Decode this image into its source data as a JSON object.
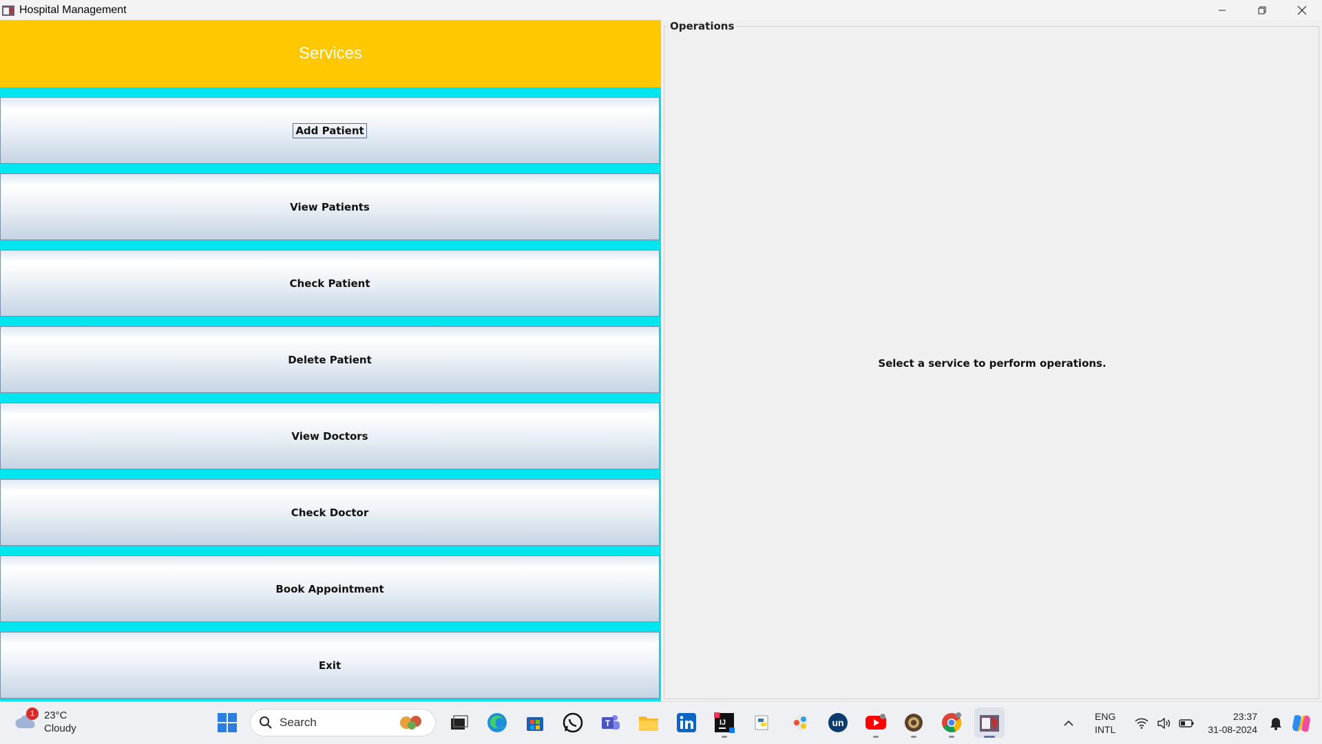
{
  "window": {
    "title": "Hospital Management"
  },
  "services": {
    "title": "Services",
    "buttons": [
      {
        "label": "Add Patient"
      },
      {
        "label": "View Patients"
      },
      {
        "label": "Check Patient"
      },
      {
        "label": "Delete Patient"
      },
      {
        "label": "View Doctors"
      },
      {
        "label": "Check Doctor"
      },
      {
        "label": "Book Appointment"
      },
      {
        "label": "Exit"
      }
    ]
  },
  "operations": {
    "title": "Operations",
    "message": "Select a service to perform operations."
  },
  "taskbar": {
    "weather": {
      "temperature": "23°C",
      "condition": "Cloudy",
      "badge": "1"
    },
    "search_placeholder": "Search",
    "language": {
      "line1": "ENG",
      "line2": "INTL"
    },
    "clock": {
      "time": "23:37",
      "date": "31-08-2024"
    }
  },
  "colors": {
    "services_header": "#ffc800",
    "services_background": "#00e5ee",
    "operations_background": "#f0f0f0"
  }
}
